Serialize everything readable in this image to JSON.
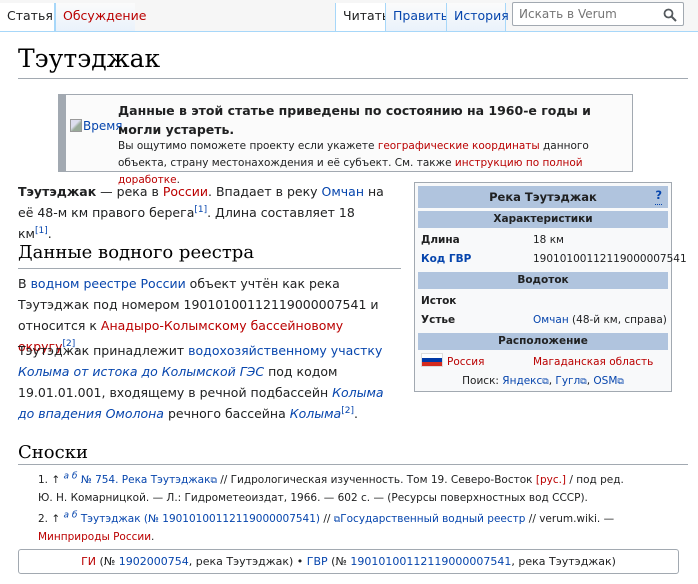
{
  "tabs": {
    "article": "Статья",
    "talk": "Обсуждение",
    "read": "Читать",
    "edit": "Править",
    "history": "История"
  },
  "search": {
    "placeholder": "Искать в Verum"
  },
  "page": {
    "title": "Тэутэджак"
  },
  "notice": {
    "image_alt": "Время",
    "title": "Данные в этой статье приведены по состоянию на 1960-е годы и могли устареть.",
    "text_1": "Вы ощутимо поможете проекту если укажете ",
    "link_coords": "географические координаты",
    "text_2": " данного объекта, страну местонахождения и её субъект. См. также ",
    "link_guide": "инструкцию по полной доработке",
    "text_3": "."
  },
  "lead": {
    "name": "Тэутэджак",
    "t1": " — река в ",
    "russia": "России",
    "t2": ". Впадает в реку ",
    "omchan": "Омчан",
    "t3": " на её 48-м км правого берега",
    "ref1": "[1]",
    "t4": ". Длина составляет 18 км",
    "ref2": "[1]",
    "t5": "."
  },
  "registry": {
    "heading": "Данные водного реестра",
    "p1_t1": "В ",
    "p1_link1": "водном реестре России",
    "p1_t2": " объект учтён как река Тэутэджак под номером 19010100112119000007541 и относится к ",
    "p1_link2": "Анадыро-Колымскому бассейновому округу",
    "p1_ref": "[2]",
    "p1_t3": ".",
    "p2_t1": "Тэутэджак принадлежит ",
    "p2_link1": "водохозяйственному участку",
    "p2_link2": "Колыма от истока до Колымской ГЭС",
    "p2_t2": " под кодом 19.01.01.001, входящему в речной подбассейн ",
    "p2_link3": "Колыма до впадения Омолона",
    "p2_t3": " речного бассейна ",
    "p2_link4": "Колыма",
    "p2_ref": "[2]",
    "p2_t4": "."
  },
  "notes": {
    "heading": "Сноски",
    "n1_num": "1.",
    "n1_back": "↑",
    "n1_ab": "а б",
    "n1_link": "№ 754. Река Тэутэджак",
    "n1_t1": " // Гидрологическая изученность. Том 19. Северо-Восток ",
    "n1_rus": "[рус.]",
    "n1_t2": " / под ред. Ю. Н. Комарницкой. — Л.: Гидрометеоиздат, 1966. — 602 с. — (Ресурсы поверхностных вод СССР).",
    "n2_num": "2.",
    "n2_back": "↑",
    "n2_ab": "а б",
    "n2_link1": "Тэутэджак (№ 19010100112119000007541)",
    "n2_t1": " // ",
    "n2_link2": "Государственный водный реестр",
    "n2_t2": " // verum.wiki. — ",
    "n2_link3": "Минприроды России",
    "n2_t3": "."
  },
  "navbox": {
    "gi": "ГИ",
    "t1": " (№ ",
    "gi_num": "1902000754",
    "t2": ", река Тэутэджак) • ",
    "gvr": "ГВР",
    "t3": " (№ ",
    "gvr_num": "19010100112119000007541",
    "t4": ", река Тэутэджак)"
  },
  "infobox": {
    "title": "Река Тэутэджак",
    "help": "?",
    "sec_char": "Характеристики",
    "length_k": "Длина",
    "length_v": "18 км",
    "gvr_k": "Код ГВР",
    "gvr_v": "19010100112119000007541",
    "sec_flow": "Водоток",
    "source_k": "Исток",
    "mouth_k": "Устье",
    "mouth_link": "Омчан",
    "mouth_rest": " (48-й км, справа)",
    "sec_loc": "Расположение",
    "country": "Россия",
    "region": "Магаданская область",
    "search_label": "Поиск: ",
    "s1": "Яндекс",
    "s2": "Гугл",
    "s3": "OSM",
    "ext": "⧉",
    "sep": ", "
  },
  "colors": {
    "link": "#0645ad",
    "redlink": "#ba0000",
    "header": "#b0c4de"
  }
}
